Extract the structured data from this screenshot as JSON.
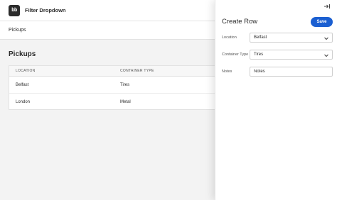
{
  "app": {
    "logo_text": "bb",
    "title": "Filter Dropdown"
  },
  "nav": {
    "link": "Pickups"
  },
  "main": {
    "heading": "Pickups",
    "table": {
      "columns": [
        "LOCATION",
        "CONTAINER TYPE"
      ],
      "rows": [
        {
          "location": "Belfast",
          "container_type": "Tires"
        },
        {
          "location": "London",
          "container_type": "Metal"
        }
      ]
    }
  },
  "panel": {
    "title": "Create Row",
    "save_label": "Save",
    "close_icon": "close-panel-icon",
    "fields": {
      "location": {
        "label": "Location",
        "value": "Belfast"
      },
      "container_type": {
        "label": "Container Type",
        "value": "Tires"
      },
      "notes": {
        "label": "Notes",
        "placeholder": "Notes"
      }
    }
  },
  "colors": {
    "accent": "#1b5fd1",
    "logo_bg": "#2b2b2b"
  }
}
